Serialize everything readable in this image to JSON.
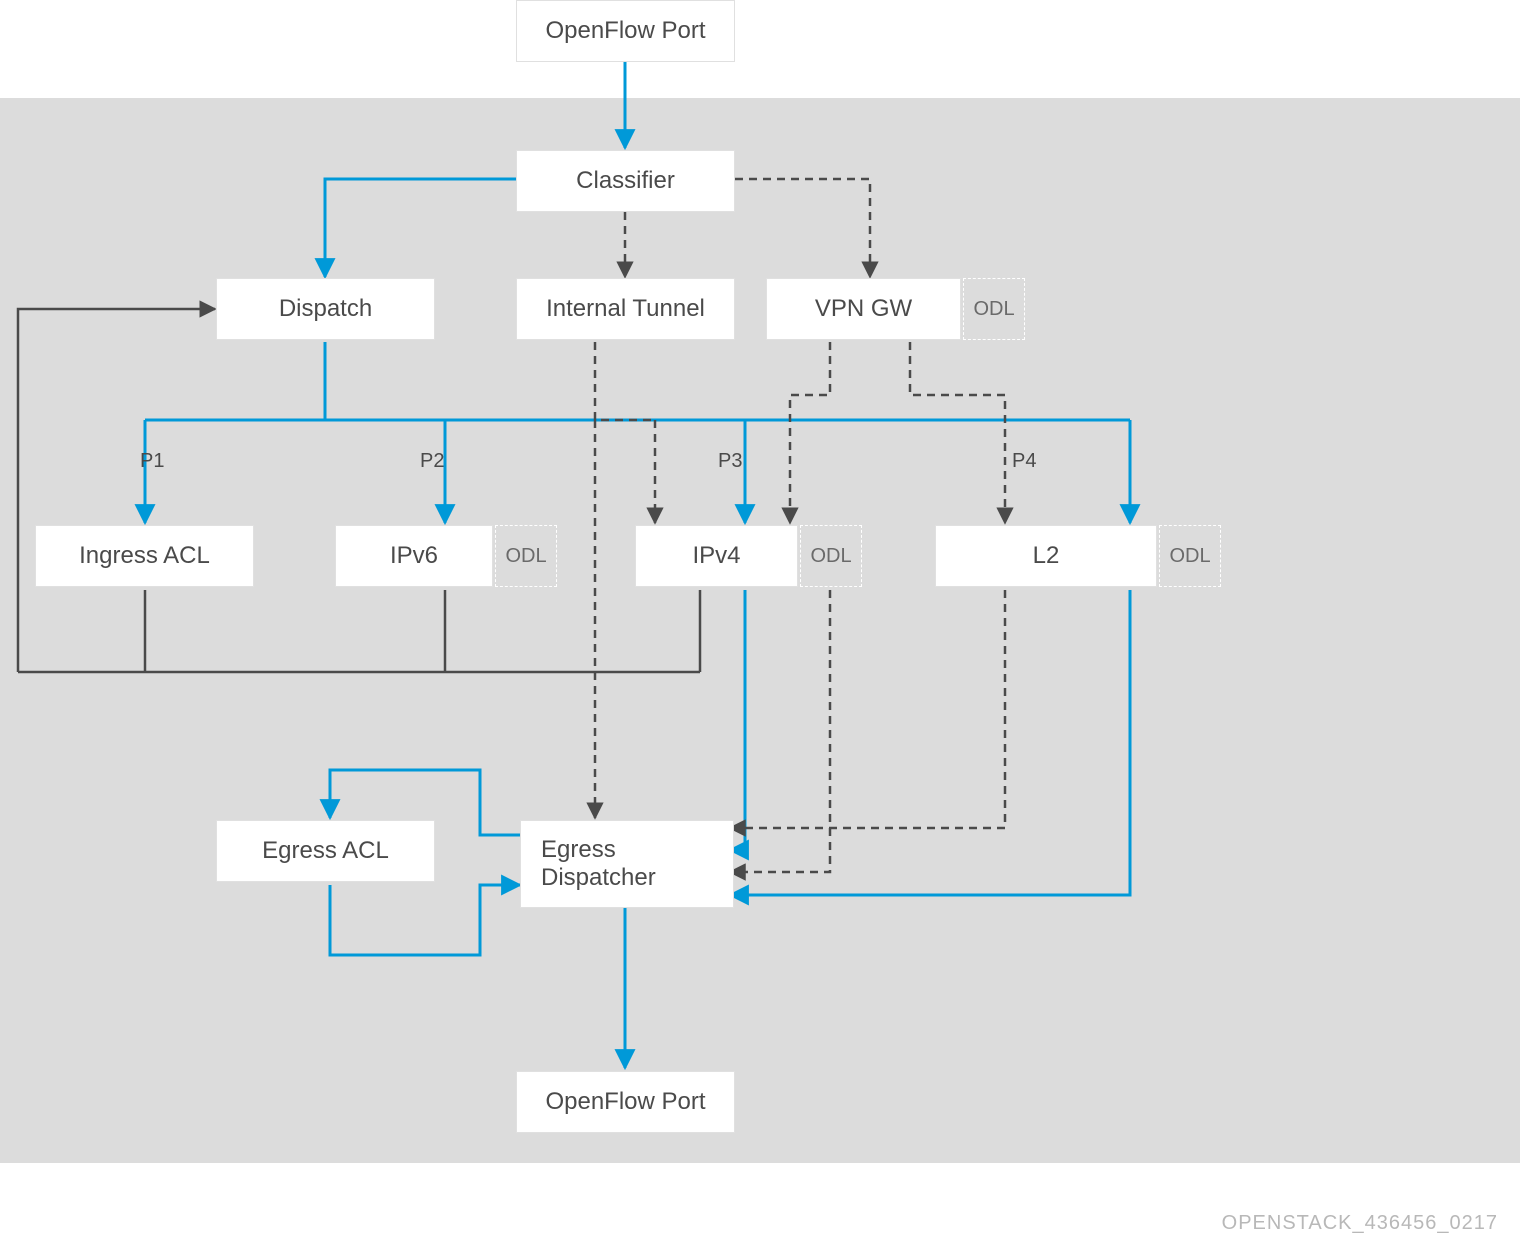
{
  "watermark": "OPENSTACK_436456_0217",
  "nodes": {
    "openflow_top": "OpenFlow Port",
    "classifier": "Classifier",
    "dispatch": "Dispatch",
    "internal_tunnel": "Internal Tunnel",
    "vpn_gw": "VPN GW",
    "ingress_acl": "Ingress ACL",
    "ipv6": "IPv6",
    "ipv4": "IPv4",
    "l2": "L2",
    "egress_acl": "Egress ACL",
    "egress_dispatcher": "Egress Dispatcher",
    "openflow_bottom": "OpenFlow Port"
  },
  "odl": "ODL",
  "labels": {
    "p1": "P1",
    "p2": "P2",
    "p3": "P3",
    "p4": "P4"
  },
  "colors": {
    "blue": "#0099d8",
    "gray": "#4a4a4a",
    "bg": "#dcdcdc"
  }
}
